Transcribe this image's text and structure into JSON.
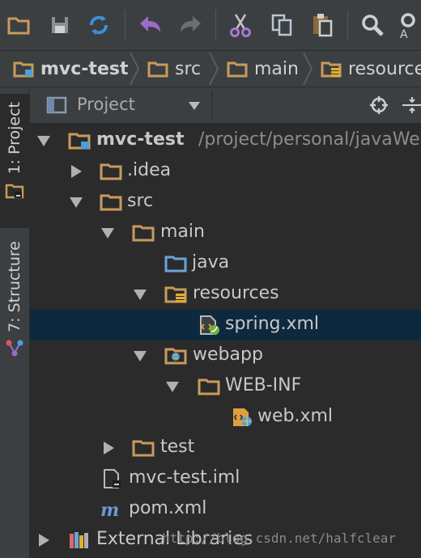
{
  "toolbar": {
    "buttons": [
      "open-icon",
      "save-icon",
      "sync-icon",
      "undo-icon",
      "redo-icon",
      "cut-icon",
      "copy-icon",
      "paste-icon",
      "find-icon",
      "replace-icon"
    ]
  },
  "breadcrumb": [
    {
      "label": "mvc-test",
      "icon": "module-folder-icon"
    },
    {
      "label": "src",
      "icon": "folder-icon"
    },
    {
      "label": "main",
      "icon": "folder-icon"
    },
    {
      "label": "resources",
      "icon": "resources-folder-icon"
    }
  ],
  "side_tabs": {
    "project": "1: Project",
    "structure": "7: Structure"
  },
  "panel": {
    "title": "Project"
  },
  "tree": [
    {
      "label": "mvc-test",
      "path": "/project/personal/javaWeb",
      "icon": "module-folder-icon",
      "expanded": true
    },
    {
      "label": ".idea",
      "icon": "folder-icon",
      "expanded": false
    },
    {
      "label": "src",
      "icon": "folder-icon",
      "expanded": true
    },
    {
      "label": "main",
      "icon": "folder-icon",
      "expanded": true
    },
    {
      "label": "java",
      "icon": "source-folder-icon"
    },
    {
      "label": "resources",
      "icon": "resources-folder-icon",
      "expanded": true
    },
    {
      "label": "spring.xml",
      "icon": "spring-xml-icon",
      "selected": true
    },
    {
      "label": "webapp",
      "icon": "web-folder-icon",
      "expanded": true
    },
    {
      "label": "WEB-INF",
      "icon": "folder-icon",
      "expanded": true
    },
    {
      "label": "web.xml",
      "icon": "web-xml-icon"
    },
    {
      "label": "test",
      "icon": "folder-icon",
      "expanded": false
    },
    {
      "label": "mvc-test.iml",
      "icon": "iml-file-icon"
    },
    {
      "label": "pom.xml",
      "icon": "maven-icon"
    },
    {
      "label": "External Libraries",
      "icon": "libraries-icon",
      "expanded": false
    }
  ],
  "watermark": "http://blog.csdn.net/halfclear",
  "colors": {
    "folder": "#c89b5c",
    "source_folder": "#6aa4d8",
    "selection": "#0d293e",
    "panel_bg": "#2b2b2b",
    "chrome_bg": "#3c3f41"
  }
}
